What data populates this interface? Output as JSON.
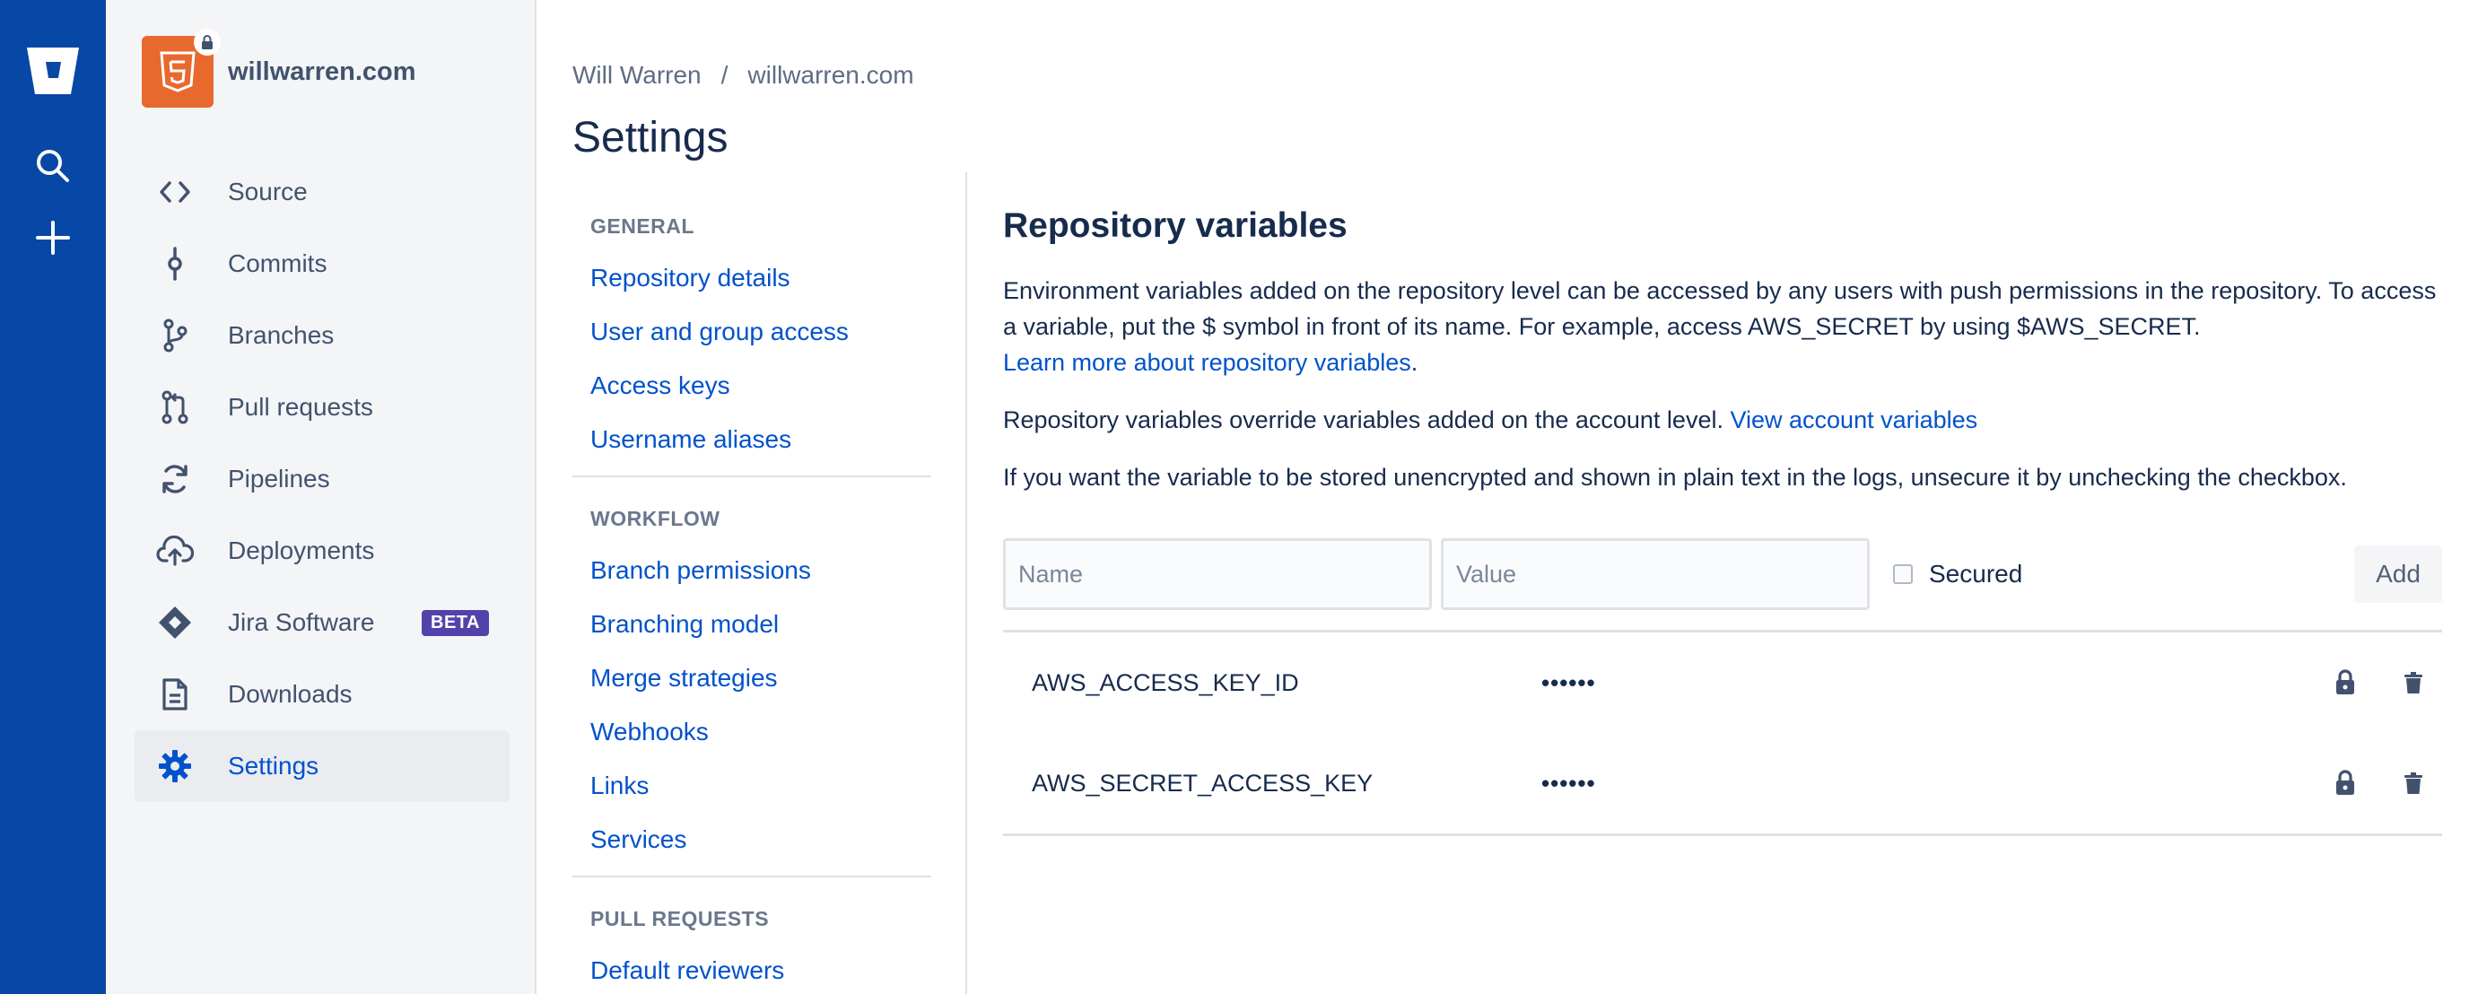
{
  "repo": {
    "name": "willwarren.com"
  },
  "sidebar": {
    "items": [
      {
        "label": "Source",
        "icon": "code-icon"
      },
      {
        "label": "Commits",
        "icon": "commit-icon"
      },
      {
        "label": "Branches",
        "icon": "branch-icon"
      },
      {
        "label": "Pull requests",
        "icon": "pull-request-icon"
      },
      {
        "label": "Pipelines",
        "icon": "pipelines-icon"
      },
      {
        "label": "Deployments",
        "icon": "deployments-icon"
      },
      {
        "label": "Jira Software",
        "icon": "jira-icon",
        "badge": "BETA"
      },
      {
        "label": "Downloads",
        "icon": "downloads-icon"
      },
      {
        "label": "Settings",
        "icon": "settings-icon",
        "active": true
      }
    ]
  },
  "breadcrumb": {
    "owner": "Will Warren",
    "sep": "/",
    "repo": "willwarren.com"
  },
  "page": {
    "title": "Settings"
  },
  "settings_nav": {
    "general": {
      "heading": "GENERAL",
      "links": [
        "Repository details",
        "User and group access",
        "Access keys",
        "Username aliases"
      ]
    },
    "workflow": {
      "heading": "WORKFLOW",
      "links": [
        "Branch permissions",
        "Branching model",
        "Merge strategies",
        "Webhooks",
        "Links",
        "Services"
      ]
    },
    "pull_requests": {
      "heading": "PULL REQUESTS",
      "links": [
        "Default reviewers"
      ]
    }
  },
  "content": {
    "title": "Repository variables",
    "p1": "Environment variables added on the repository level can be accessed by any users with push permissions in the repository. To access a variable, put the $ symbol in front of its name. For example, access AWS_SECRET by using $AWS_SECRET.",
    "p1_link": "Learn more about repository variables",
    "p1_end": ".",
    "p2": "Repository variables override variables added on the account level.",
    "p2_link": "View account variables",
    "p3": "If you want the variable to be stored unencrypted and shown in plain text in the logs, unsecure it by unchecking the checkbox."
  },
  "form": {
    "name_placeholder": "Name",
    "value_placeholder": "Value",
    "secured_label": "Secured",
    "add_label": "Add"
  },
  "variables": [
    {
      "name": "AWS_ACCESS_KEY_ID",
      "value": "••••••"
    },
    {
      "name": "AWS_SECRET_ACCESS_KEY",
      "value": "••••••"
    }
  ],
  "colors": {
    "global_nav": "#0747a6",
    "accent": "#0052cc",
    "repo_avatar": "#e8692e",
    "beta_badge": "#5243aa"
  }
}
